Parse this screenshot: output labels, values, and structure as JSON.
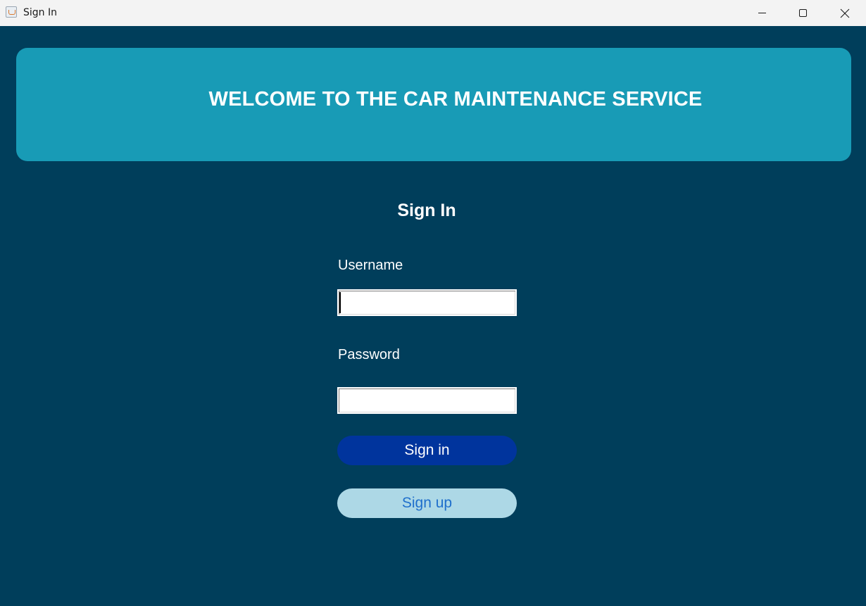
{
  "window": {
    "title": "Sign In",
    "controls": [
      "minimize-icon",
      "maximize-icon",
      "close-icon"
    ]
  },
  "banner": {
    "title": "WELCOME TO THE CAR MAINTENANCE SERVICE"
  },
  "form": {
    "title": "Sign In",
    "username_label": "Username",
    "username_value": "",
    "password_label": "Password",
    "password_value": "",
    "signin_label": "Sign in",
    "signup_label": "Sign up"
  },
  "colors": {
    "background": "#003e5b",
    "banner": "#189bb6",
    "signin_button": "#00349d",
    "signup_button": "#add8e6",
    "signup_text": "#1f6fcc"
  }
}
